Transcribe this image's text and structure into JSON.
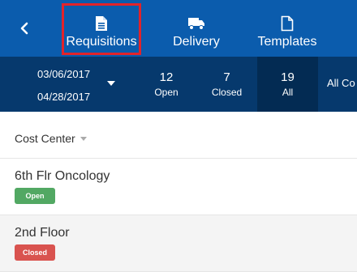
{
  "nav": {
    "back_icon": "chevron-left-icon",
    "tabs": [
      {
        "label": "Requisitions",
        "icon": "document-icon",
        "selected": true
      },
      {
        "label": "Delivery",
        "icon": "truck-icon"
      },
      {
        "label": "Templates",
        "icon": "blank-document-icon"
      }
    ]
  },
  "filters": {
    "date_start": "03/06/2017",
    "date_end": "04/28/2017",
    "counts": [
      {
        "value": "12",
        "label": "Open"
      },
      {
        "value": "7",
        "label": "Closed"
      },
      {
        "value": "19",
        "label": "All"
      }
    ],
    "status_filter": "All Co"
  },
  "sort": {
    "label": "Cost Center"
  },
  "items": [
    {
      "title": "6th Flr Oncology",
      "status": "Open"
    },
    {
      "title": "2nd Floor",
      "status": "Closed"
    }
  ],
  "colors": {
    "nav_bg": "#0b5cad",
    "filter_bg": "#06396d",
    "open_badge": "#52a863",
    "closed_badge": "#d9534f",
    "highlight": "#e2232a"
  }
}
